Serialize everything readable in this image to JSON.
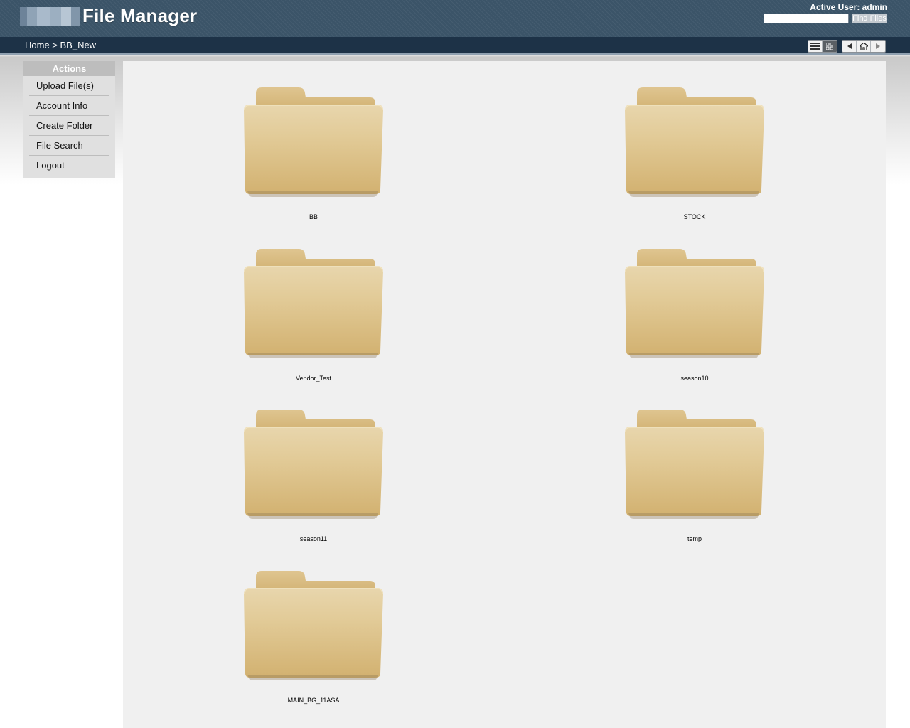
{
  "header": {
    "title": "File Manager",
    "active_user": "Active User: admin",
    "search": {
      "value": "",
      "placeholder": ""
    },
    "find_button_label": "Find Files",
    "bg_color": "#3b5468"
  },
  "navbar": {
    "breadcrumb": "Home > BB_New",
    "view_controls": [
      "list-view-icon",
      "icon-view-icon"
    ],
    "nav_controls": [
      "back-arrow-icon",
      "home-icon",
      "forward-arrow-icon"
    ]
  },
  "sidebar": {
    "header": "Actions",
    "items": [
      {
        "label": "Upload File(s)"
      },
      {
        "label": "Account Info"
      },
      {
        "label": "Create Folder"
      },
      {
        "label": "File Search"
      },
      {
        "label": "Logout"
      }
    ]
  },
  "folders": [
    {
      "name": "BB"
    },
    {
      "name": "STOCK"
    },
    {
      "name": "Vendor_Test"
    },
    {
      "name": "season10"
    },
    {
      "name": "season11"
    },
    {
      "name": "temp"
    },
    {
      "name": "MAIN_BG_11ASA"
    }
  ],
  "colors": {
    "folder_light": "#e6d2a6",
    "folder_dark": "#d4b67c",
    "folder_tab": "#d9bf88",
    "content_bg": "#f0f0f0",
    "navbar_bg": "#1d3247"
  }
}
